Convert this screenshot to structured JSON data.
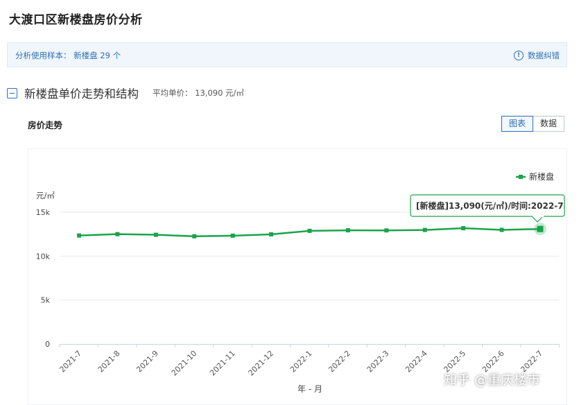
{
  "page": {
    "title": "大渡口区新楼盘房价分析"
  },
  "sample_bar": {
    "text": "分析使用样本：  新楼盘 29 个",
    "correct_label": "数据纠错",
    "info_icon": "info-icon"
  },
  "section": {
    "title": "新楼盘单价走势和结构",
    "avg_price": "平均单价：  13,090 元/㎡"
  },
  "chart_panel": {
    "title": "房价走势",
    "tabs": [
      "图表",
      "数据"
    ],
    "active_tab": "图表"
  },
  "watermark": "知乎 @重庆楼市",
  "chart_data": {
    "type": "line",
    "categories": [
      "2021-7",
      "2021-8",
      "2021-9",
      "2021-10",
      "2021-11",
      "2021-12",
      "2022-1",
      "2022-2",
      "2022-3",
      "2022-4",
      "2022-5",
      "2022-6",
      "2022-7"
    ],
    "series": [
      {
        "name": "新楼盘",
        "color": "#1aa34a",
        "values": [
          12350,
          12500,
          12430,
          12260,
          12330,
          12480,
          12880,
          12940,
          12930,
          12980,
          13180,
          12990,
          13090
        ]
      }
    ],
    "ylabel": "元/㎡",
    "xlabel": "年 - 月",
    "ylim": [
      0,
      15000
    ],
    "yticks": [
      0,
      5000,
      10000,
      15000
    ],
    "yticklabels": [
      "0",
      "5k",
      "10k",
      "15k"
    ],
    "grid": true,
    "legend": "top-right",
    "tooltip": {
      "text": "[新楼盘]13,090(元/㎡)/时间:2022-7",
      "index": 12
    }
  }
}
